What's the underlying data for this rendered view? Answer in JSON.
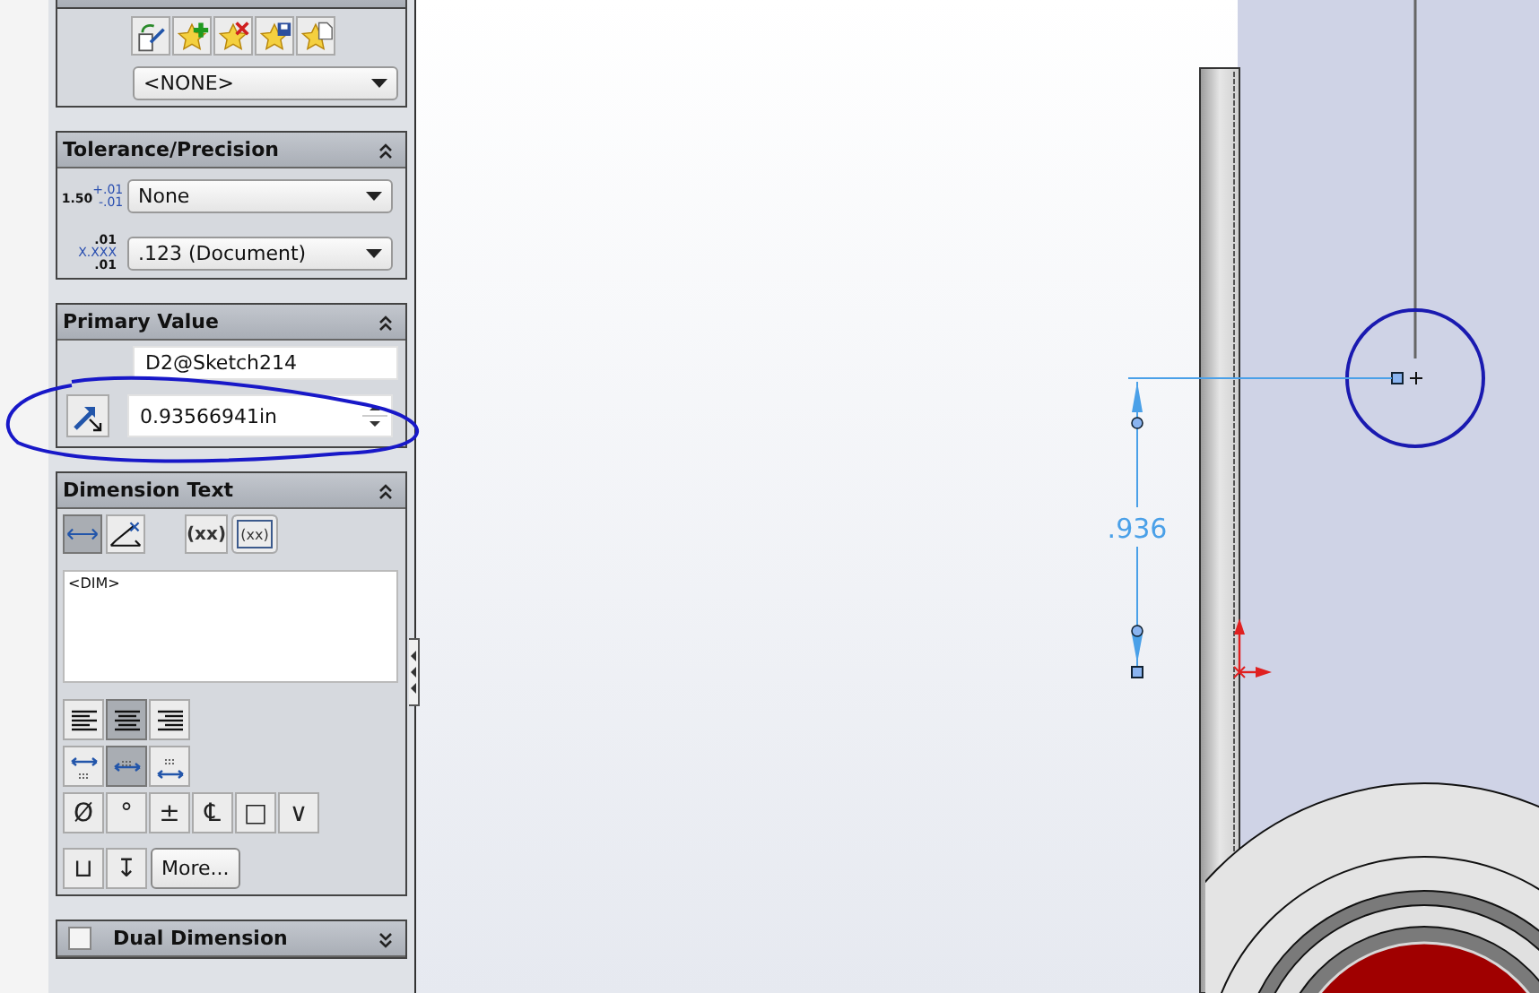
{
  "favorites": {
    "dropdown": "<NONE>"
  },
  "tolerance_precision": {
    "title": "Tolerance/Precision",
    "expanded": true,
    "tolerance_icon": {
      "value": "1.50",
      "upper": "+.01",
      "lower": "-.01"
    },
    "tolerance_dropdown": "None",
    "precision_icon": {
      "top": ".01",
      "middle": "X.XXX",
      "bottom": ".01"
    },
    "precision_dropdown": ".123 (Document)"
  },
  "primary_value": {
    "title": "Primary Value",
    "expanded": true,
    "name_field": "D2@Sketch214",
    "value_field": "0.93566941in"
  },
  "dimension_text": {
    "title": "Dimension Text",
    "expanded": true,
    "placement_buttons": [
      {
        "selected": true
      },
      {
        "selected": false
      }
    ],
    "paren_buttons": [
      {
        "label": "(xx)",
        "kind": "plain"
      },
      {
        "label": "(xx)",
        "kind": "oval"
      }
    ],
    "text": "<DIM>",
    "justify_buttons": [
      {
        "selected": false
      },
      {
        "selected": true
      },
      {
        "selected": false
      }
    ],
    "arrow_buttons": [
      {
        "selected": false
      },
      {
        "selected": true
      },
      {
        "selected": false
      }
    ],
    "symbol_buttons": [
      {
        "label": "Ø"
      },
      {
        "label": "°"
      },
      {
        "label": "±"
      },
      {
        "label": "℄"
      },
      {
        "label": "□"
      },
      {
        "label": "∨"
      },
      {
        "label": "⊔"
      },
      {
        "label": "↧"
      }
    ],
    "more_button": "More..."
  },
  "dual_dimension": {
    "title": "Dual Dimension",
    "checked": false,
    "expanded": false
  },
  "graphics": {
    "dimension_label": ".936"
  }
}
